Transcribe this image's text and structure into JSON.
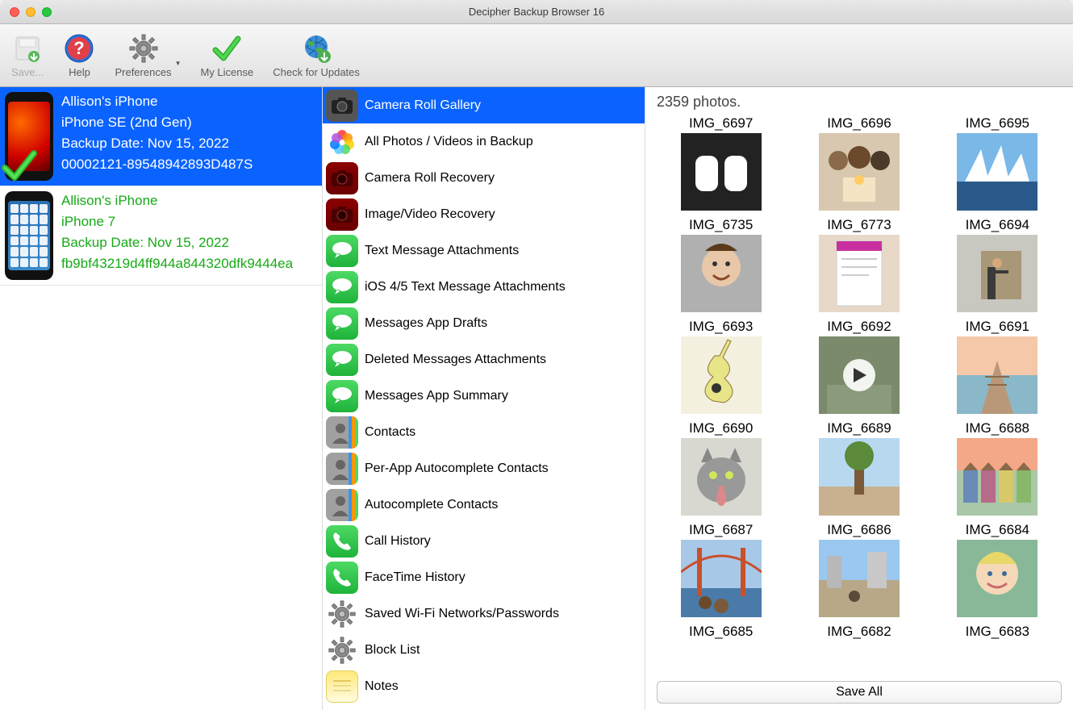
{
  "window_title": "Decipher Backup Browser 16",
  "toolbar": {
    "save": "Save...",
    "help": "Help",
    "prefs": "Preferences",
    "license": "My License",
    "updates": "Check for Updates"
  },
  "devices": [
    {
      "name": "Allison's iPhone",
      "model": "iPhone SE (2nd Gen)",
      "backup": "Backup Date: Nov 15, 2022",
      "id": "00002121-89548942893D487S",
      "selected": true,
      "screen": "red",
      "check": true
    },
    {
      "name": "Allison's iPhone",
      "model": "iPhone 7",
      "backup": "Backup Date: Nov 15, 2022",
      "id": "fb9bf43219d4ff944a844320dfk9444ea",
      "selected": false,
      "screen": "apps",
      "check": false
    }
  ],
  "categories": [
    {
      "label": "Camera Roll Gallery",
      "icon": "camera-grey",
      "selected": true
    },
    {
      "label": "All Photos / Videos in Backup",
      "icon": "photos"
    },
    {
      "label": "Camera Roll Recovery",
      "icon": "camera-red"
    },
    {
      "label": "Image/Video Recovery",
      "icon": "camera-red"
    },
    {
      "label": "Text Message Attachments",
      "icon": "msg"
    },
    {
      "label": "iOS 4/5 Text Message Attachments",
      "icon": "msg"
    },
    {
      "label": "Messages App Drafts",
      "icon": "msg"
    },
    {
      "label": "Deleted Messages Attachments",
      "icon": "msg"
    },
    {
      "label": "Messages App Summary",
      "icon": "msg"
    },
    {
      "label": "Contacts",
      "icon": "contact"
    },
    {
      "label": "Per-App Autocomplete Contacts",
      "icon": "contact"
    },
    {
      "label": "Autocomplete Contacts",
      "icon": "contact"
    },
    {
      "label": "Call History",
      "icon": "phone"
    },
    {
      "label": "FaceTime History",
      "icon": "phone"
    },
    {
      "label": "Saved Wi-Fi Networks/Passwords",
      "icon": "gear"
    },
    {
      "label": "Block List",
      "icon": "gear"
    },
    {
      "label": "Notes",
      "icon": "note"
    }
  ],
  "photo_count": "2359 photos.",
  "photos": [
    {
      "name": "IMG_6697",
      "kind": "shoes"
    },
    {
      "name": "IMG_6696",
      "kind": "friends"
    },
    {
      "name": "IMG_6695",
      "kind": "opera"
    },
    {
      "name": "IMG_6735",
      "kind": "baby"
    },
    {
      "name": "IMG_6773",
      "kind": "note"
    },
    {
      "name": "IMG_6694",
      "kind": "chair"
    },
    {
      "name": "IMG_6693",
      "kind": "guitar"
    },
    {
      "name": "IMG_6692",
      "kind": "video"
    },
    {
      "name": "IMG_6691",
      "kind": "pier"
    },
    {
      "name": "IMG_6690",
      "kind": "cat"
    },
    {
      "name": "IMG_6689",
      "kind": "tree"
    },
    {
      "name": "IMG_6688",
      "kind": "houses"
    },
    {
      "name": "IMG_6687",
      "kind": "bridge"
    },
    {
      "name": "IMG_6686",
      "kind": "street"
    },
    {
      "name": "IMG_6684",
      "kind": "child"
    },
    {
      "name": "IMG_6685",
      "kind": ""
    },
    {
      "name": "IMG_6682",
      "kind": ""
    },
    {
      "name": "IMG_6683",
      "kind": ""
    }
  ],
  "save_all": "Save All"
}
